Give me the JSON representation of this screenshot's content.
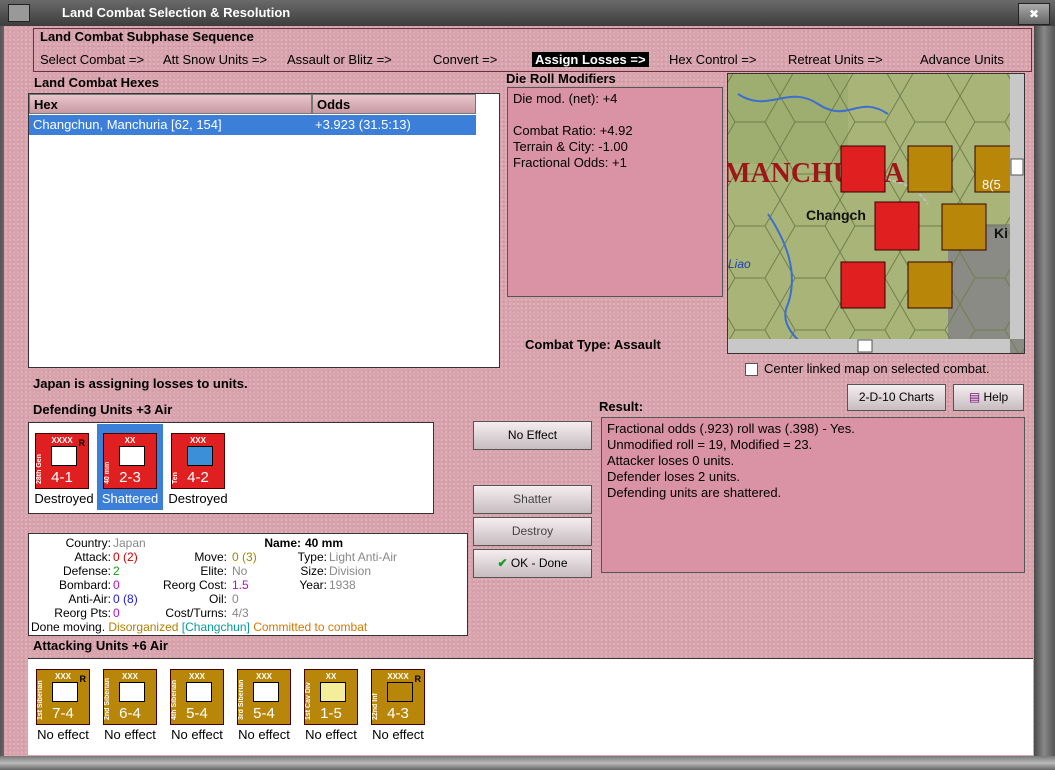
{
  "window": {
    "title": "Land Combat Selection & Resolution",
    "close": "✖"
  },
  "subphase": {
    "title": "Land Combat Subphase Sequence",
    "steps": [
      "Select Combat =>",
      "Att Snow Units =>",
      "Assault or Blitz =>",
      "Convert =>",
      "Assign Losses =>",
      "Hex Control =>",
      "Retreat Units =>",
      "Advance Units"
    ]
  },
  "hexes": {
    "title": "Land Combat Hexes",
    "headers": [
      "Hex",
      "Odds"
    ],
    "row": {
      "hex": "Changchun, Manchuria [62, 154]",
      "odds": "+3.923 (31.5:13)"
    }
  },
  "modifiers": {
    "title": "Die Roll Modifiers",
    "net": "Die mod. (net): +4",
    "ratio": "Combat Ratio: +4.92",
    "terrain": "Terrain & City: -1.00",
    "fractional": "Fractional Odds: +1"
  },
  "combat_type": "Combat Type:  Assault",
  "map": {
    "region_label": "MANCHURIA",
    "city_label": "Changch",
    "river_label": "Liao",
    "edge_label": "Ki",
    "partial_counter": "8(5"
  },
  "center_linked": "Center linked map on selected combat.",
  "status_line": "Japan is assigning losses to units.",
  "buttons": {
    "charts": "2-D-10 Charts",
    "help": "Help",
    "no_effect": "No Effect",
    "shatter": "Shatter",
    "destroy": "Destroy",
    "ok": "OK - Done"
  },
  "defending": {
    "title": "Defending Units +3 Air",
    "units": [
      {
        "size": "XXXX",
        "name": "28th Gen",
        "value": "4-1",
        "status": "Destroyed",
        "r": "R"
      },
      {
        "size": "XX",
        "name": "40 mm",
        "value": "2-3",
        "status": "Shattered",
        "r": ""
      },
      {
        "size": "XXX",
        "name": "Ten",
        "value": "4-2",
        "status": "Destroyed",
        "r": ""
      }
    ]
  },
  "info": {
    "country_lbl": "Country:",
    "country": "Japan",
    "attack_lbl": "Attack:",
    "attack": "0",
    "attack2": "(2)",
    "defense_lbl": "Defense:",
    "defense": "2",
    "bombard_lbl": "Bombard:",
    "bombard": "0",
    "aa_lbl": "Anti-Air:",
    "aa": "0",
    "aa2": "(8)",
    "reorg_lbl": "Reorg Pts:",
    "reorg": "0",
    "name_lbl": "Name:",
    "name": "40 mm",
    "move_lbl": "Move:",
    "move": "0",
    "move2": "(3)",
    "type_lbl": "Type:",
    "type": "Light Anti-Air",
    "elite_lbl": "Elite:",
    "elite": "No",
    "size_lbl": "Size:",
    "size": "Division",
    "reorgcost_lbl": "Reorg Cost:",
    "reorgcost": "1.5",
    "year_lbl": "Year:",
    "year": "1938",
    "oil_lbl": "Oil:",
    "oil": "0",
    "cost_lbl": "Cost/Turns:",
    "cost": "4/3",
    "done": "Done moving.",
    "disorg": "Disorganized",
    "loc": "[Changchun]",
    "committed": "Committed to combat"
  },
  "result": {
    "title": "Result:",
    "lines": [
      "Fractional odds (.923) roll was (.398)  - Yes.",
      "Unmodified roll = 19, Modified = 23.",
      "Attacker loses 0 units.",
      "Defender loses 2 units.",
      "Defending units are shattered."
    ]
  },
  "attacking": {
    "title": "Attacking Units +6 Air",
    "units": [
      {
        "size": "XXX",
        "name": "1st Siberian",
        "value": "7-4",
        "status": "No effect",
        "r": "R"
      },
      {
        "size": "XXX",
        "name": "2nd Siberian",
        "value": "6-4",
        "status": "No effect",
        "r": ""
      },
      {
        "size": "XXX",
        "name": "4th Siberian",
        "value": "5-4",
        "status": "No effect",
        "r": ""
      },
      {
        "size": "XXX",
        "name": "3rd Siberian",
        "value": "5-4",
        "status": "No effect",
        "r": ""
      },
      {
        "size": "XX",
        "name": "1st Cav Div",
        "value": "1-5",
        "status": "No effect",
        "r": ""
      },
      {
        "size": "XXXX",
        "name": "22nd Inf",
        "value": "4-3",
        "status": "No effect",
        "r": "R"
      }
    ]
  },
  "colors": {
    "pink": "#d9a3ad",
    "selected": "#3c7fd8",
    "japan_red": "#e02020",
    "soviet_gold": "#b8870a"
  }
}
